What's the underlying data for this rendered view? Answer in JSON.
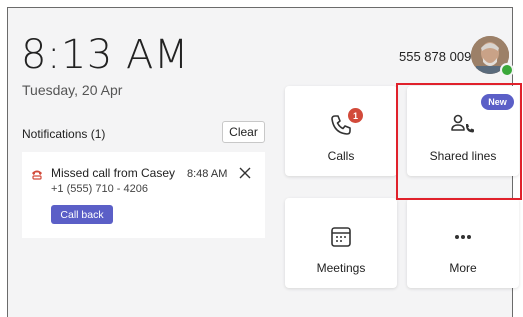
{
  "header": {
    "time": "8:13 AM",
    "date": "Tuesday, 20 Apr",
    "phone_number": "555 878 0091"
  },
  "notifications": {
    "title": "Notifications (1)",
    "clear_label": "Clear",
    "items": [
      {
        "text": "Missed call from Casey",
        "time": "8:48 AM",
        "number": "+1 (555) 710 - 4206",
        "action_label": "Call back"
      }
    ]
  },
  "tiles": [
    {
      "label": "Calls",
      "icon": "phone-icon",
      "badge": "1"
    },
    {
      "label": "Shared lines",
      "icon": "shared-lines-icon",
      "badge": "New"
    },
    {
      "label": "Meetings",
      "icon": "calendar-icon"
    },
    {
      "label": "More",
      "icon": "more-icon"
    }
  ],
  "colors": {
    "accent": "#5b5fc7",
    "badge_red": "#d24a3a",
    "highlight": "#e0212b",
    "presence": "#3aa83a"
  }
}
